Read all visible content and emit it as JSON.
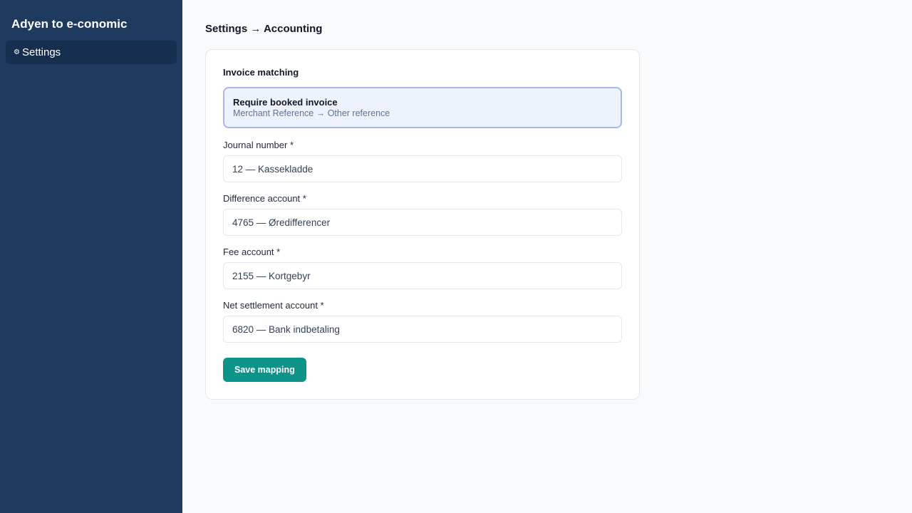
{
  "sidebar": {
    "app_title": "Adyen to e-conomic",
    "items": [
      {
        "label": "Settings",
        "icon": "gear-icon",
        "glyph": "⚙"
      }
    ]
  },
  "main": {
    "breadcrumb": "Settings → Accounting",
    "card": {
      "section_title": "Invoice matching",
      "option": {
        "title": "Require booked invoice",
        "subtitle": "Merchant Reference → Other reference"
      },
      "fields": [
        {
          "label": "Journal number *",
          "value": "12 — Kassekladde"
        },
        {
          "label": "Difference account *",
          "value": "4765 — Ørediffer­encer"
        },
        {
          "label": "Fee account *",
          "value": "2155 — Kortgebyr"
        },
        {
          "label": "Net settlement account *",
          "value": "6820 — Bank indbetaling"
        }
      ],
      "save_label": "Save mapping"
    }
  },
  "colors": {
    "sidebar_bg": "#1e3a5f",
    "nav_active_bg": "#172f4e",
    "accent_button": "#0d9488",
    "option_border": "#a5b8e8",
    "option_bg": "#edf2fd"
  }
}
